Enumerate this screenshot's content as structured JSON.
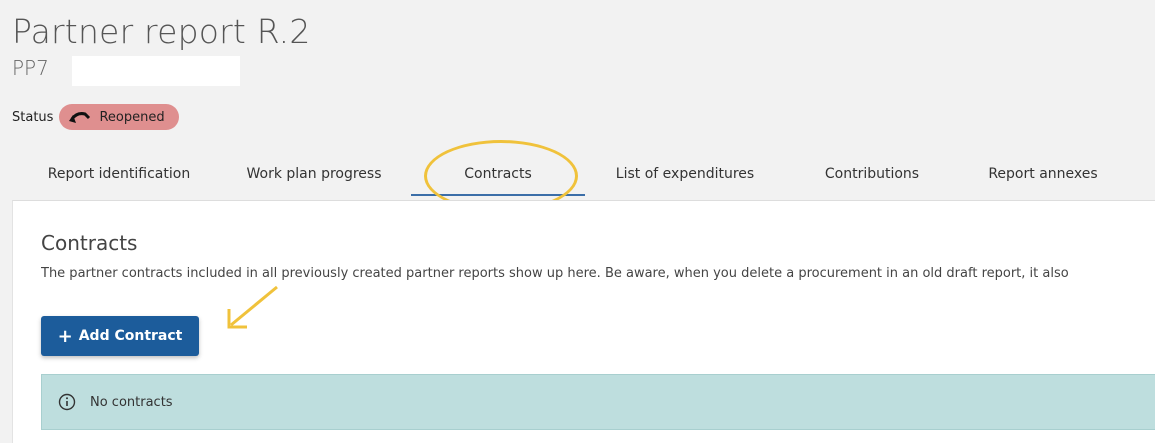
{
  "header": {
    "title": "Partner report R.2",
    "subtitle": "PP7"
  },
  "status": {
    "label": "Status",
    "value": "Reopened",
    "badge_color": "#df8f8f"
  },
  "tabs": [
    {
      "label": "Report identification",
      "active": false
    },
    {
      "label": "Work plan progress",
      "active": false
    },
    {
      "label": "Contracts",
      "active": true
    },
    {
      "label": "List of expenditures",
      "active": false
    },
    {
      "label": "Contributions",
      "active": false
    },
    {
      "label": "Report annexes",
      "active": false
    }
  ],
  "contracts": {
    "title": "Contracts",
    "description": "The partner contracts included in all previously created partner reports show up here. Be aware, when you delete a procurement in an old draft report, it also",
    "add_button_label": "Add Contract",
    "empty_message": "No contracts"
  },
  "icons": {
    "status": "undo-arrow-icon",
    "add": "plus-icon",
    "info": "info-circle-icon"
  },
  "colors": {
    "primary": "#1c5c9b",
    "info_bg": "#bedede",
    "annotation": "#f0c23b",
    "active_tab_underline": "#3b6ea8"
  }
}
